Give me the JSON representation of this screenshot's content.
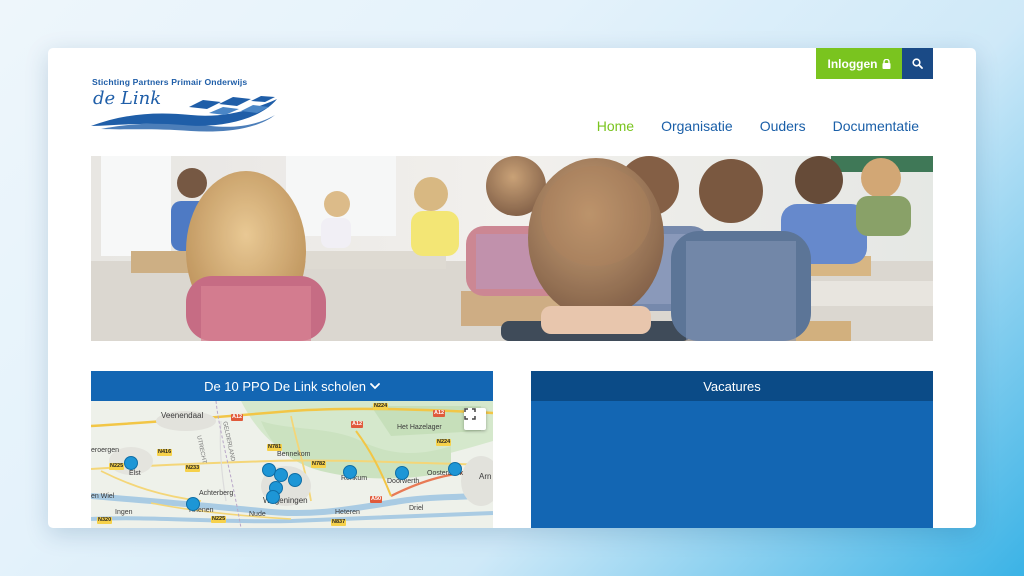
{
  "header": {
    "login_label": "Inloggen",
    "lock_icon": "lock-icon",
    "search_icon": "search-icon"
  },
  "logo": {
    "tagline": "Stichting Partners Primair Onderwijs",
    "name": "de Link"
  },
  "nav": {
    "items": [
      {
        "label": "Home",
        "active": true
      },
      {
        "label": "Organisatie",
        "active": false
      },
      {
        "label": "Ouders",
        "active": false
      },
      {
        "label": "Documentatie",
        "active": false
      }
    ]
  },
  "schools_panel": {
    "title": "De 10 PPO De Link scholen",
    "chevron_icon": "chevron-down-icon",
    "fullscreen_icon": "fullscreen-icon",
    "map_labels": {
      "veenendaal": "Veenendaal",
      "het_hazelager": "Het Hazelager",
      "bennekom": "Bennekom",
      "elst": "Elst",
      "renkum": "Renkum",
      "doorwerth": "Doorwerth",
      "oosterbeek": "Oosterbeek",
      "arnhem": "Arn",
      "achterberg": "Achterberg",
      "wageningen": "Wageningen",
      "rhenen": "Rhenen",
      "nude": "Nude",
      "heteren": "Heteren",
      "driel": "Driel",
      "ingen": "Ingen",
      "den_wiel": "en Wiel",
      "eroergen": "eroergen",
      "utrecht_region": "UTRECHT",
      "gelderland_region": "GELDERLAND"
    },
    "road_labels": {
      "a12_left": "A12",
      "n224_top": "N224",
      "a12_right": "A12",
      "n225_left": "N225",
      "n416": "N416",
      "n233": "N233",
      "n781": "N781",
      "n782": "N782",
      "n224_mid": "N224",
      "a50": "A50",
      "n225_bottom": "N225",
      "n320": "N320",
      "n837": "N837",
      "a12_top": "A12"
    }
  },
  "vacatures_panel": {
    "title": "Vacatures"
  }
}
